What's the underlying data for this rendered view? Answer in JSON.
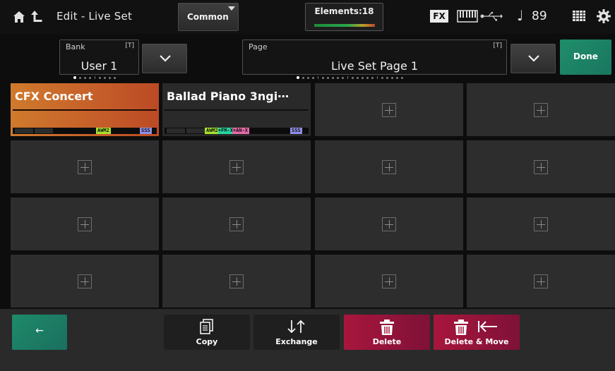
{
  "header": {
    "title": "Edit - Live Set",
    "common_tab": "Common",
    "elements_label": "Elements:18",
    "elements_level": 0.85,
    "fx_badge": "FX",
    "tempo": "89",
    "note_symbol": "♩"
  },
  "bank": {
    "label": "Bank",
    "tag": "[T]",
    "value": "User 1"
  },
  "page": {
    "label": "Page",
    "tag": "[T]",
    "value": "Live Set Page 1"
  },
  "done_label": "Done",
  "slots": [
    {
      "name": "CFX Concert",
      "selected": true,
      "tags": [
        {
          "text": "AWM2",
          "color": "#a6e22e"
        },
        {
          "text": "SSS",
          "color": "#8f8fe8"
        }
      ]
    },
    {
      "name": "Ballad Piano 3ngi⋯",
      "selected": false,
      "tags": [
        {
          "text": "AWM2+FM-X+AN-X",
          "color": "mixed"
        },
        {
          "text": "SSS",
          "color": "#8f8fe8"
        }
      ]
    },
    {
      "empty": true
    },
    {
      "empty": true
    },
    {
      "empty": true
    },
    {
      "empty": true
    },
    {
      "empty": true
    },
    {
      "empty": true
    },
    {
      "empty": true
    },
    {
      "empty": true
    },
    {
      "empty": true
    },
    {
      "empty": true
    },
    {
      "empty": true
    },
    {
      "empty": true
    },
    {
      "empty": true
    },
    {
      "empty": true
    }
  ],
  "toolbar": {
    "back_label": "←",
    "copy_label": "Copy",
    "exchange_label": "Exchange",
    "delete_label": "Delete",
    "delete_move_label": "Delete & Move"
  },
  "colors": {
    "accent_teal": "#1e8a6a",
    "selected_orange": "#c6602a",
    "delete_red": "#a8163c"
  }
}
